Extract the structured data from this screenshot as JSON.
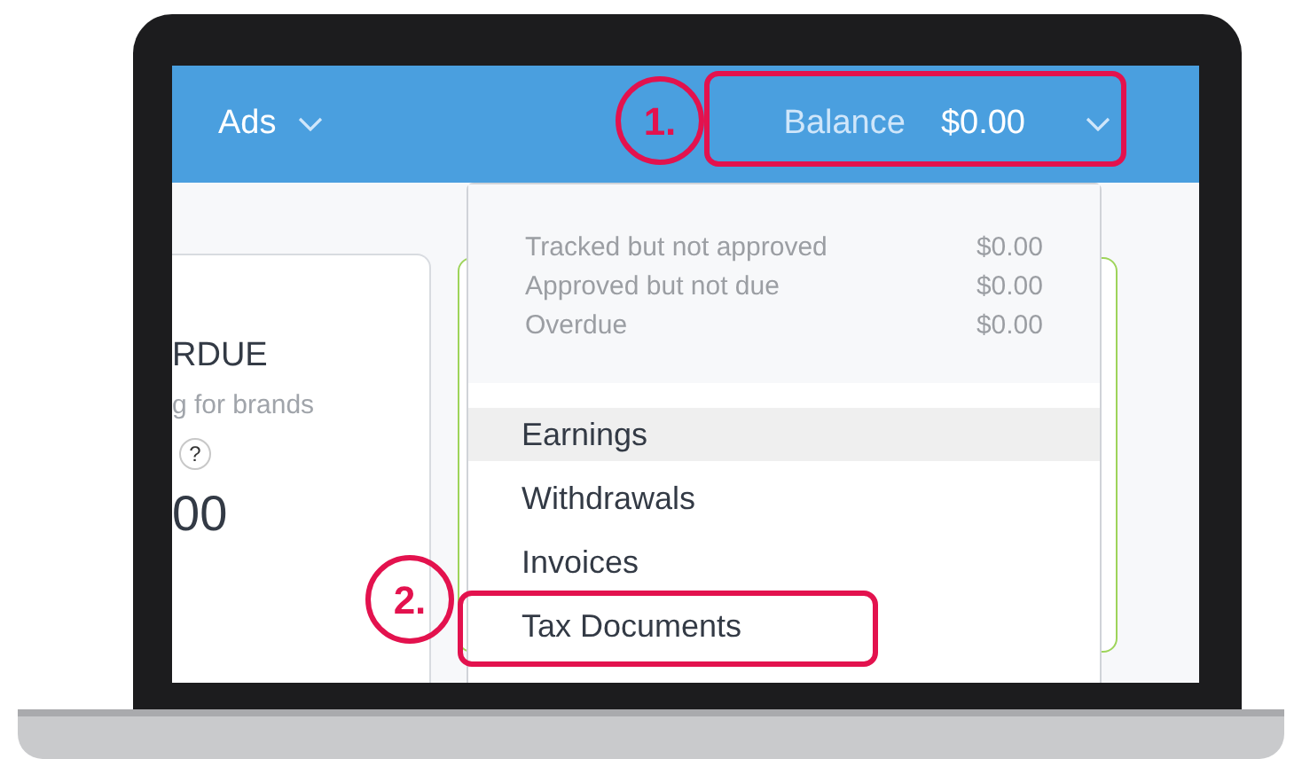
{
  "header": {
    "nav_label": "Ads",
    "balance_label": "Balance",
    "balance_value": "$0.00",
    "balance_expanded": true
  },
  "left_card": {
    "title": "RDUE",
    "subtitle": "g for brands",
    "help": "?",
    "amount": "00"
  },
  "dropdown": {
    "summary": [
      {
        "label": "Tracked but not approved",
        "value": "$0.00"
      },
      {
        "label": "Approved but not due",
        "value": "$0.00"
      },
      {
        "label": "Overdue",
        "value": "$0.00"
      }
    ],
    "items": [
      {
        "label": "Earnings",
        "selected": true
      },
      {
        "label": "Withdrawals",
        "selected": false
      },
      {
        "label": "Invoices",
        "selected": false
      },
      {
        "label": "Tax Documents",
        "selected": false
      }
    ]
  },
  "annotations": [
    {
      "number": "1."
    },
    {
      "number": "2."
    }
  ]
}
